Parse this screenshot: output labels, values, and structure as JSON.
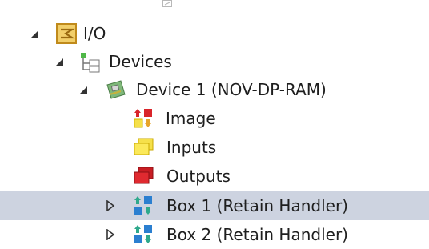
{
  "tree": {
    "io": {
      "label": "I/O",
      "icon": "io-folder-icon"
    },
    "devices": {
      "label": "Devices",
      "icon": "devices-tree-icon"
    },
    "device1": {
      "label": "Device 1 (NOV-DP-RAM)",
      "icon": "device-card-icon"
    },
    "image": {
      "label": "Image",
      "icon": "image-icon"
    },
    "inputs": {
      "label": "Inputs",
      "icon": "inputs-icon"
    },
    "outputs": {
      "label": "Outputs",
      "icon": "outputs-icon"
    },
    "box1": {
      "label": "Box 1 (Retain Handler)",
      "icon": "box-icon",
      "selected": true
    },
    "box2": {
      "label": "Box 2 (Retain Handler)",
      "icon": "box-icon"
    }
  },
  "colors": {
    "selection": "#cdd3e0",
    "io_folder": "#e7b73b",
    "inputs": "#f5e04a",
    "outputs": "#d9242a",
    "box": "#2b7fd0"
  }
}
